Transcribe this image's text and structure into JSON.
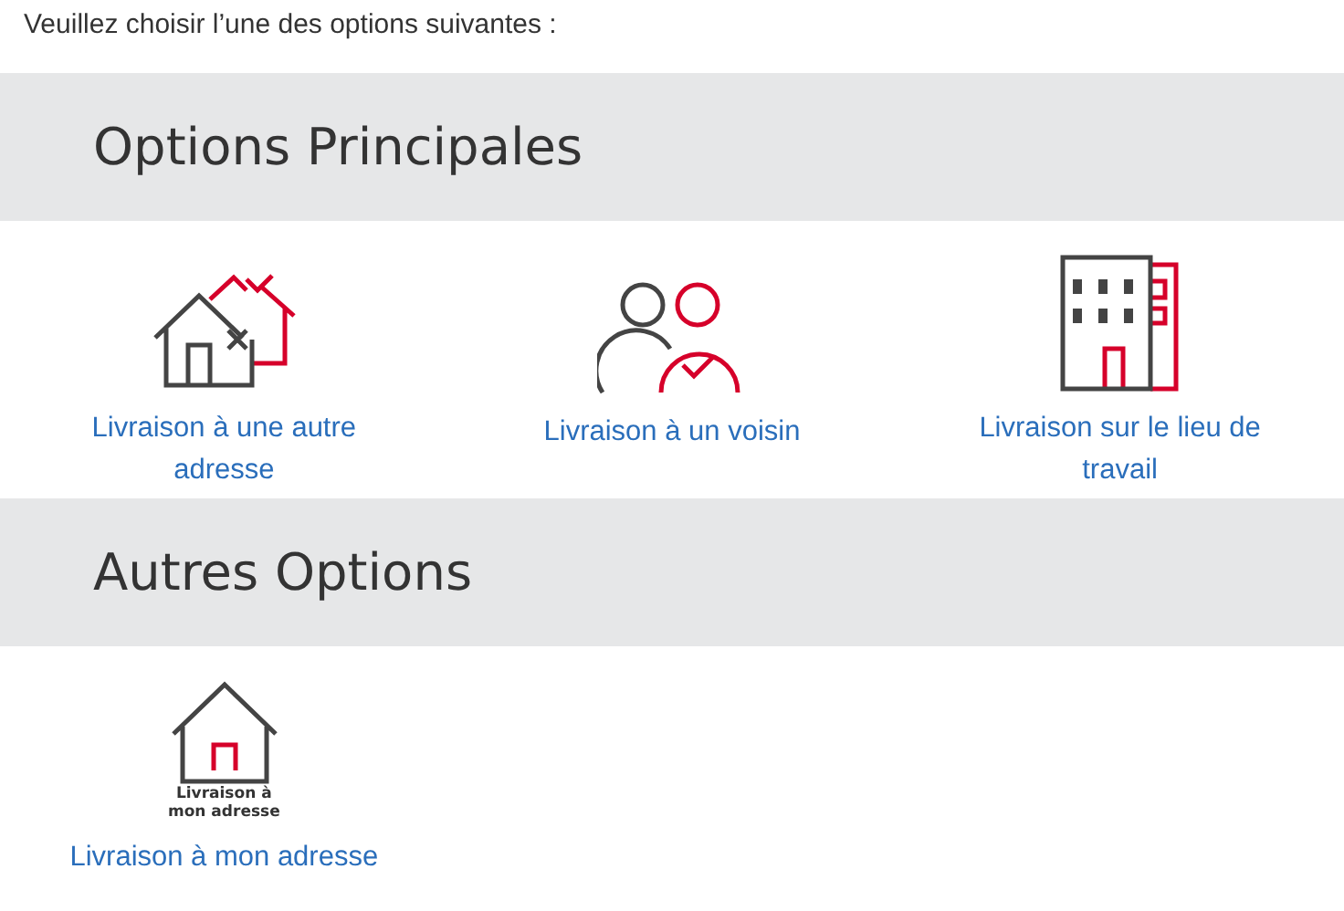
{
  "intro": "Veuillez choisir l’une des options suivantes :",
  "sections": [
    {
      "title": "Options Principales",
      "options": [
        {
          "kind": "other-address",
          "label": "Livraison à une autre adresse"
        },
        {
          "kind": "neighbor",
          "label": "Livraison à un voisin"
        },
        {
          "kind": "workplace",
          "label": "Livraison sur le lieu de travail"
        }
      ]
    },
    {
      "title": "Autres Options",
      "options": [
        {
          "kind": "my-address",
          "label": "Livraison à mon adresse",
          "icon_caption": "Livraison à mon adresse"
        }
      ]
    }
  ]
}
